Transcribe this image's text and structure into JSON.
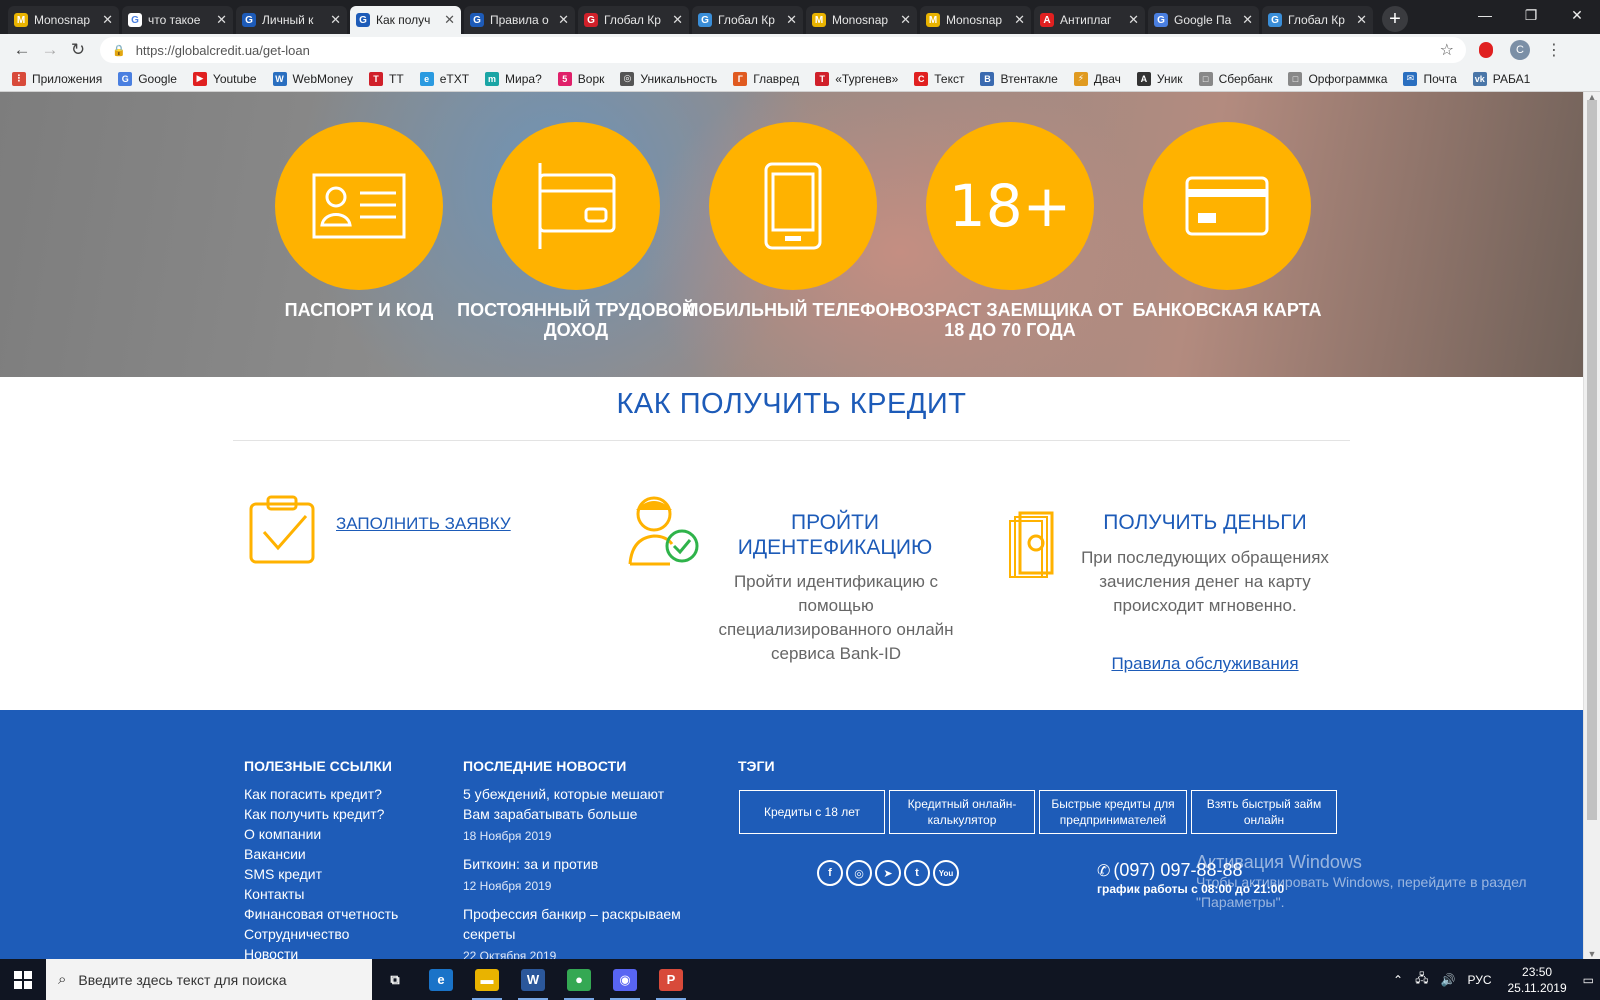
{
  "browser": {
    "tabs": [
      {
        "title": "Monosnap",
        "fav_color": "#e9b300",
        "fav_char": "M"
      },
      {
        "title": "что такое",
        "fav_color": "#ffffff",
        "fav_char": "G"
      },
      {
        "title": "Личный к",
        "fav_color": "#1d5bb8",
        "fav_char": "G"
      },
      {
        "title": "Как получ",
        "fav_color": "#1d5bb8",
        "fav_char": "G",
        "active": true
      },
      {
        "title": "Правила о",
        "fav_color": "#1d5bb8",
        "fav_char": "G"
      },
      {
        "title": "Глобал Кр",
        "fav_color": "#d0202a",
        "fav_char": "G"
      },
      {
        "title": "Глобал Кр",
        "fav_color": "#3a8ed8",
        "fav_char": "G"
      },
      {
        "title": "Monosnap",
        "fav_color": "#e9b300",
        "fav_char": "M"
      },
      {
        "title": "Monosnap",
        "fav_color": "#e9b300",
        "fav_char": "M"
      },
      {
        "title": "Антиплаг",
        "fav_color": "#e02020",
        "fav_char": "A"
      },
      {
        "title": "Google Па",
        "fav_color": "#4a7fe0",
        "fav_char": "G"
      },
      {
        "title": "Глобал Кр",
        "fav_color": "#3a8ed8",
        "fav_char": "G"
      }
    ],
    "url": "https://globalcredit.ua/get-loan",
    "avatar_letter": "С",
    "bookmarks": [
      {
        "label": "Приложения",
        "color": "#d84a3a",
        "char": "⋮"
      },
      {
        "label": "Google",
        "color": "#4a7fe0",
        "char": "G"
      },
      {
        "label": "Youtube",
        "color": "#e02020",
        "char": "▶"
      },
      {
        "label": "WebMoney",
        "color": "#2a6fc0",
        "char": "W"
      },
      {
        "label": "ТТ",
        "color": "#d0202a",
        "char": "T"
      },
      {
        "label": "eTXT",
        "color": "#2a9ae0",
        "char": "e"
      },
      {
        "label": "Мира?",
        "color": "#1aa5a5",
        "char": "m"
      },
      {
        "label": "Ворк",
        "color": "#e0206a",
        "char": "5"
      },
      {
        "label": "Уникальность",
        "color": "#555555",
        "char": "◎"
      },
      {
        "label": "Главред",
        "color": "#e05a20",
        "char": "Г"
      },
      {
        "label": "«Тургенев»",
        "color": "#d0202a",
        "char": "T"
      },
      {
        "label": "Текст",
        "color": "#e02020",
        "char": "C"
      },
      {
        "label": "Втентакле",
        "color": "#3a6ab0",
        "char": "В"
      },
      {
        "label": "Двач",
        "color": "#e09a20",
        "char": "⚡"
      },
      {
        "label": "Уник",
        "color": "#333333",
        "char": "A"
      },
      {
        "label": "Сбербанк",
        "color": "#888888",
        "char": "□"
      },
      {
        "label": "Орфограммка",
        "color": "#888888",
        "char": "□"
      },
      {
        "label": "Почта",
        "color": "#2a6fc0",
        "char": "✉"
      },
      {
        "label": "РАБА1",
        "color": "#4a76a8",
        "char": "vk"
      }
    ]
  },
  "hero": {
    "items": [
      {
        "label": "ПАСПОРТ И КОД",
        "icon": "passport-icon"
      },
      {
        "label": "ПОСТОЯННЫЙ ТРУДОВОЙ ДОХОД",
        "icon": "income-icon"
      },
      {
        "label": "МОБИЛЬНЫЙ ТЕЛЕФОН",
        "icon": "phone-icon"
      },
      {
        "label": "ВОЗРАСТ ЗАЕМЩИКА ОТ 18 ДО 70 ГОДА",
        "icon": "age-icon",
        "age_text": "18+"
      },
      {
        "label": "БАНКОВСКАЯ КАРТА",
        "icon": "bank-card-icon"
      }
    ],
    "accent": "#ffb200"
  },
  "how": {
    "title": "КАК ПОЛУЧИТЬ КРЕДИТ",
    "step1": {
      "link": "ЗАПОЛНИТЬ ЗАЯВКУ",
      "icon": "clipboard-icon"
    },
    "step2": {
      "title": "ПРОЙТИ ИДЕНТЕФИКАЦИЮ",
      "text": "Пройти идентификацию с помощью специализированного онлайн сервиса Bank-ID",
      "icon": "identification-icon"
    },
    "step3": {
      "title": "ПОЛУЧИТЬ ДЕНЬГИ",
      "text": "При последующих обращениях зачисления денег на карту происходит мгновенно.",
      "link": "Правила обслуживания",
      "icon": "money-icon"
    }
  },
  "footer": {
    "useful_title": "ПОЛЕЗНЫЕ ССЫЛКИ",
    "useful_links": [
      "Как погасить кредит?",
      "Как получить кредит?",
      "О компании",
      "Вакансии",
      "SMS кредит",
      "Контакты",
      "Финансовая отчетность",
      "Сотрудничество",
      "Новости"
    ],
    "news_title": "ПОСЛЕДНИЕ НОВОСТИ",
    "news": [
      {
        "title": "5 убеждений, которые мешают Вам зарабатывать больше",
        "date": "18 Ноября 2019"
      },
      {
        "title": "Биткоин: за и против",
        "date": "12 Ноября 2019"
      },
      {
        "title": "Профессия банкир – раскрываем секреты",
        "date": "22 Октября 2019"
      }
    ],
    "tags_title": "ТЭГИ",
    "tags": [
      "Кредиты с 18 лет",
      "Кредитный онлайн-калькулятор",
      "Быстрые кредиты для предпринимателей",
      "Взять быстрый займ онлайн"
    ],
    "social": [
      "f",
      "◎",
      "➤",
      "t",
      "You"
    ],
    "phone": "(097) 097-88-88",
    "hours": "график работы с 08:00 до 21:00",
    "color": "#1e5cb8"
  },
  "watermark": {
    "line1": "Активация Windows",
    "line2": "Чтобы активировать Windows, перейдите в раздел",
    "line3": "\"Параметры\"."
  },
  "taskbar": {
    "search_placeholder": "Введите здесь текст для поиска",
    "apps": [
      {
        "name": "task-view",
        "char": "⧉",
        "color": "transparent"
      },
      {
        "name": "edge",
        "char": "e",
        "color": "#1a73c8"
      },
      {
        "name": "explorer",
        "char": "▬",
        "color": "#e9b300"
      },
      {
        "name": "word",
        "char": "W",
        "color": "#2b579a"
      },
      {
        "name": "chrome",
        "char": "●",
        "color": "#34a853"
      },
      {
        "name": "discord",
        "char": "◉",
        "color": "#5865f2"
      },
      {
        "name": "paint",
        "char": "P",
        "color": "#d84a3a"
      }
    ],
    "lang": "РУС",
    "time": "23:50",
    "date": "25.11.2019"
  }
}
